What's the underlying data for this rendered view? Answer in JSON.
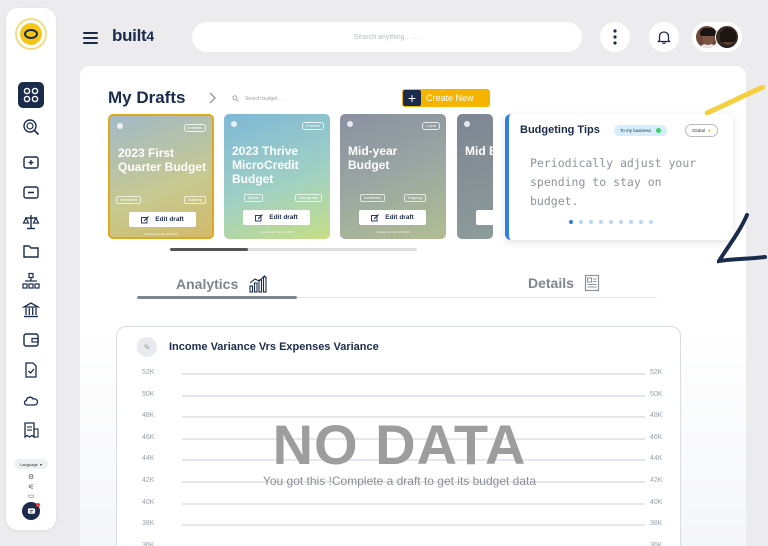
{
  "header": {
    "brand": "built",
    "brand_suffix": "4",
    "search_placeholder": "Search anything . . . ."
  },
  "sidebar": {
    "items": [
      {
        "icon": "grid-icon"
      },
      {
        "icon": "coin-search-icon"
      },
      {
        "icon": "wallet-add-icon"
      },
      {
        "icon": "wallet-minus-icon"
      },
      {
        "icon": "scale-icon"
      },
      {
        "icon": "folder-icon"
      },
      {
        "icon": "org-chart-icon"
      },
      {
        "icon": "bank-icon"
      },
      {
        "icon": "wallet-icon"
      },
      {
        "icon": "checklist-icon"
      },
      {
        "icon": "cloud-icon"
      },
      {
        "icon": "invoice-icon"
      }
    ],
    "language_label": "Language"
  },
  "drafts": {
    "title": "My Drafts",
    "search_placeholder": "Search budget . . .",
    "create_label": "Create New",
    "cards": [
      {
        "title": "2023 First Quarter Budget",
        "badge": "6 months",
        "tags": [
          "Investment",
          "Outgoing"
        ],
        "edit": "Edit draft",
        "created": "Created on: Nov 15 2023"
      },
      {
        "title": "2023 Thrive MicroCredit Budget",
        "badge": "3 months",
        "tags": [
          "Bullets",
          "Savings add"
        ],
        "edit": "Edit draft",
        "created": "Created on: Nov 15 2023"
      },
      {
        "title": "Mid-year Budget",
        "badge": "1 year",
        "tags": [
          "Investment",
          "Outgoing"
        ],
        "edit": "Edit draft",
        "created": "Created on: Nov 15 2023"
      },
      {
        "title": "Mid Bud",
        "badge": "",
        "tags": [],
        "edit": "",
        "created": ""
      }
    ]
  },
  "tips": {
    "title": "Budgeting Tips",
    "scope_label": "To my business",
    "global_label": "Global",
    "text": "Periodically adjust your spending to stay on budget.",
    "dot_count": 9,
    "active_dot": 0
  },
  "tabs": {
    "analytics": "Analytics",
    "details": "Details"
  },
  "chart": {
    "title": "Income Variance  Vrs Expenses Variance",
    "no_data": "NO DATA",
    "no_data_sub": "You got this !Complete a draft to get its budget data",
    "y_labels": [
      "52K",
      "50K",
      "48K",
      "46K",
      "44K",
      "42K",
      "40K",
      "38K",
      "36K"
    ]
  },
  "chart_data": {
    "type": "line",
    "title": "Income Variance  Vrs Expenses Variance",
    "y_ticks": [
      "52K",
      "50K",
      "48K",
      "46K",
      "44K",
      "42K",
      "40K",
      "38K",
      "36K"
    ],
    "series": [],
    "grid": true
  }
}
